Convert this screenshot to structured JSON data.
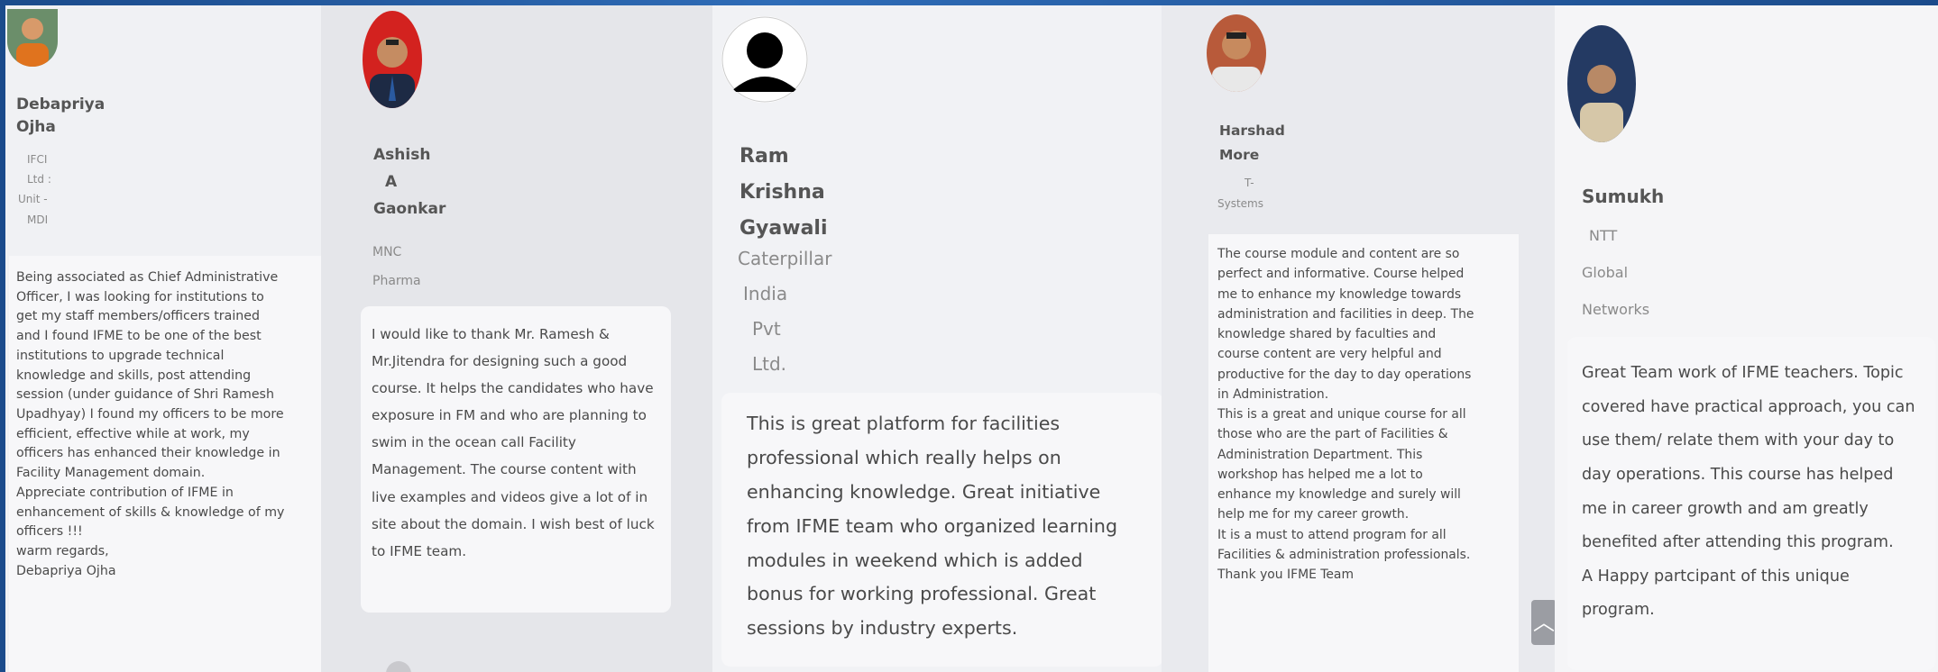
{
  "testimonials": [
    {
      "name_lines": [
        "Debapriya",
        "Ojha"
      ],
      "org_lines": [
        "IFCI",
        "Ltd :",
        "Unit -",
        "MDI"
      ],
      "text": "Being associated as Chief Administrative\nOfficer, I was looking for institutions to\nget my staff members/officers trained\nand I found IFME to be one of the best\ninstitutions to upgrade technical\nknowledge and skills, post attending\nsession (under guidance of Shri Ramesh\nUpadhyay) I found my officers to be more\nefficient, effective while at work, my\nofficers has enhanced their knowledge in\nFacility Management domain.\nAppreciate contribution of IFME in\nenhancement of skills & knowledge of my\nofficers !!!\nwarm regards,\nDebapriya Ojha"
    },
    {
      "name_lines": [
        "Ashish",
        "A",
        "Gaonkar"
      ],
      "org_lines": [
        "MNC",
        "Pharma"
      ],
      "text": "I would like to thank Mr. Ramesh &\nMr.Jitendra for designing such a good\ncourse. It helps the candidates who have\nexposure in FM and who are planning to\nswim in the ocean call Facility\nManagement. The course content with\nlive examples and videos give a lot of in\nsite about the domain. I wish best of luck\nto IFME team."
    },
    {
      "name_lines": [
        "Ram",
        "Krishna",
        "Gyawali"
      ],
      "org_lines": [
        "Caterpillar",
        "India",
        "Pvt",
        "Ltd."
      ],
      "text": "This is great platform for facilities\nprofessional which really helps on\nenhancing knowledge. Great initiative\nfrom IFME team who organized learning\nmodules in weekend which is added\nbonus for working professional. Great\nsessions by industry experts."
    },
    {
      "name_lines": [
        "Harshad",
        "More"
      ],
      "org_lines": [
        "T-",
        "Systems"
      ],
      "text": "The course module and content are so\nperfect and informative. Course helped\nme to enhance my knowledge towards\nadministration and facilities in deep. The\nknowledge shared by faculties and\ncourse content are very helpful and\nproductive for the day to day operations\nin Administration.\nThis is a great and unique course for all\nthose who are the part of Facilities &\nAdministration Department. This\nworkshop has helped me a lot to\nenhance my knowledge and surely will\nhelp me for my career growth.\nIt is a must to attend program for all\nFacilities & administration professionals.\nThank you IFME Team"
    },
    {
      "name_lines": [
        "Sumukh"
      ],
      "org_lines": [
        "NTT",
        "Global",
        "Networks"
      ],
      "text": "Great Team work of IFME teachers. Topic\ncovered have practical approach, you can\nuse them/ relate them with your day to\nday operations. This course has helped\nme in career growth and am greatly\nbenefited after attending this program.\nA Happy partcipant of this unique\nprogram."
    }
  ],
  "scroll_up_icon": "chevron-up-icon",
  "colors": {
    "frame": "#1f4f8f",
    "card": "#f7f7f9",
    "text": "#4a4a4a"
  }
}
